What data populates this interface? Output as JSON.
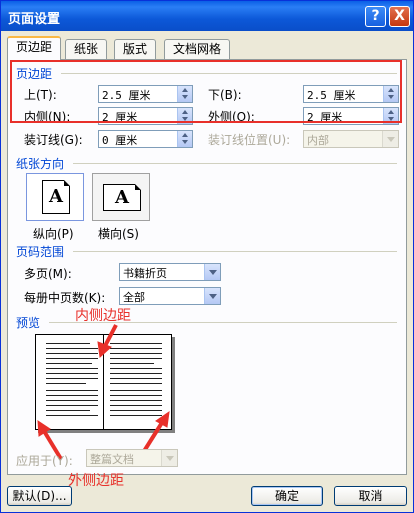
{
  "window": {
    "title": "页面设置",
    "help_label": "?",
    "close_label": "X"
  },
  "tabs": [
    "页边距",
    "纸张",
    "版式",
    "文档网格"
  ],
  "margins": {
    "section_label": "页边距",
    "top": {
      "label": "上(T):",
      "value": "2.5 厘米"
    },
    "bottom": {
      "label": "下(B):",
      "value": "2.5 厘米"
    },
    "inside": {
      "label": "内侧(N):",
      "value": "2 厘米"
    },
    "outside": {
      "label": "外侧(O):",
      "value": "2 厘米"
    },
    "gutter": {
      "label": "装订线(G):",
      "value": "0 厘米"
    },
    "gutter_position": {
      "label": "装订线位置(U):",
      "value": "内部"
    }
  },
  "orientation": {
    "section_label": "纸张方向",
    "glyph": "A",
    "portrait_label": "纵向(P)",
    "landscape_label": "横向(S)",
    "selected": "portrait"
  },
  "pages": {
    "section_label": "页码范围",
    "multiple_pages": {
      "label": "多页(M):",
      "value": "书籍折页"
    },
    "sheets_per_booklet": {
      "label": "每册中页数(K):",
      "value": "全部"
    }
  },
  "preview": {
    "section_label": "预览",
    "apply_to_label": "应用于(Y):",
    "apply_to_value": "整篇文档"
  },
  "annotations": {
    "inside_margin": "内侧边距",
    "outside_margin": "外侧边距",
    "color": "#e8302a"
  },
  "buttons": {
    "default": "默认(D)...",
    "ok": "确定",
    "cancel": "取消"
  }
}
